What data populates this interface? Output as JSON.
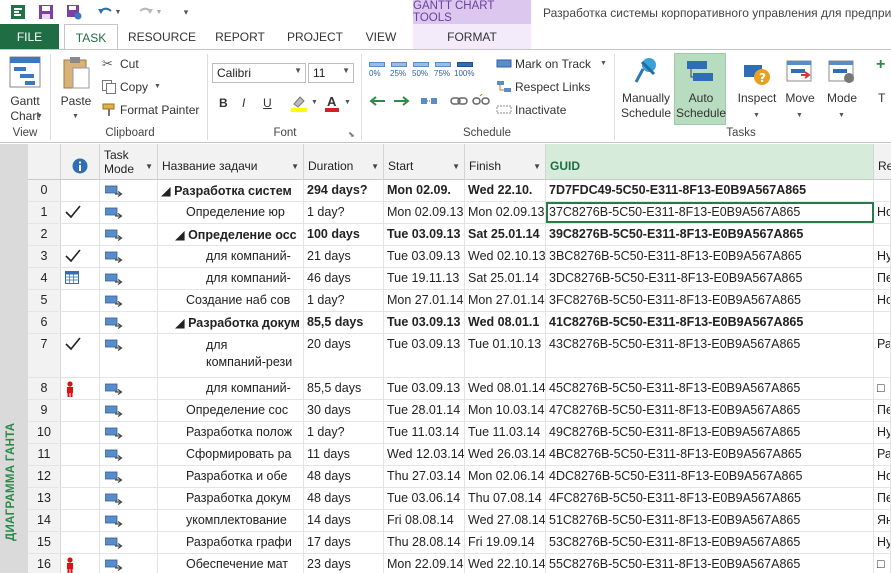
{
  "title": {
    "context_tab": "GANTT CHART TOOLS",
    "document_title": "Разработка системы корпоративного управления для предпри"
  },
  "tabs": {
    "file": "FILE",
    "task": "TASK",
    "resource": "RESOURCE",
    "report": "REPORT",
    "project": "PROJECT",
    "view": "VIEW",
    "format": "FORMAT"
  },
  "ribbon": {
    "view": {
      "gantt_line1": "Gantt",
      "gantt_line2": "Chart",
      "label": "View"
    },
    "clipboard": {
      "paste": "Paste",
      "cut": "Cut",
      "copy": "Copy",
      "format_painter": "Format Painter",
      "label": "Clipboard"
    },
    "font": {
      "family": "Calibri",
      "size": "11",
      "bold": "B",
      "italic": "I",
      "underline": "U",
      "label": "Font"
    },
    "schedule": {
      "pct": [
        "0%",
        "25%",
        "50%",
        "75%",
        "100%"
      ],
      "mark_on_track": "Mark on Track",
      "respect_links": "Respect Links",
      "inactivate": "Inactivate",
      "label": "Schedule"
    },
    "tasks": {
      "manually_line1": "Manually",
      "manually_line2": "Schedule",
      "auto_line1": "Auto",
      "auto_line2": "Schedule",
      "inspect": "Inspect",
      "move": "Move",
      "mode": "Mode",
      "label": "Tasks"
    }
  },
  "sidebar": {
    "view_name": "ДИАГРАММА ГАНТА"
  },
  "table": {
    "headers": {
      "indicator": "i",
      "task_mode_line1": "Task",
      "task_mode_line2": "Mode",
      "name": "Название задачи",
      "duration": "Duration",
      "start": "Start",
      "finish": "Finish",
      "guid": "GUID",
      "extra": "Re"
    },
    "rows": [
      {
        "id": "0",
        "ind": "",
        "name": "◢ Разработка систем",
        "level": 0,
        "bold": true,
        "duration": "294 days?",
        "start": "Mon 02.09.",
        "finish": "Wed 22.10.",
        "guid": "7D7FDC49-5C50-E311-8F13-E0B9A567A865",
        "extra": ""
      },
      {
        "id": "1",
        "ind": "check",
        "name": "Определение юр",
        "level": 2,
        "bold": false,
        "duration": "1 day?",
        "start": "Mon 02.09.13",
        "finish": "Mon 02.09.13",
        "guid": "37C8276B-5C50-E311-8F13-E0B9A567A865",
        "extra": "Но"
      },
      {
        "id": "2",
        "ind": "",
        "name": "◢ Определение осс",
        "level": 1,
        "bold": true,
        "duration": "100 days",
        "start": "Tue 03.09.13",
        "finish": "Sat 25.01.14",
        "guid": "39C8276B-5C50-E311-8F13-E0B9A567A865",
        "extra": ""
      },
      {
        "id": "3",
        "ind": "check",
        "name": "для компаний-",
        "level": 3,
        "bold": false,
        "duration": "21 days",
        "start": "Tue 03.09.13",
        "finish": "Wed 02.10.13",
        "guid": "3BC8276B-5C50-E311-8F13-E0B9A567A865",
        "extra": "Ну"
      },
      {
        "id": "4",
        "ind": "calendar",
        "name": "для компаний-",
        "level": 3,
        "bold": false,
        "duration": "46 days",
        "start": "Tue 19.11.13",
        "finish": "Sat 25.01.14",
        "guid": "3DC8276B-5C50-E311-8F13-E0B9A567A865",
        "extra": "Пе"
      },
      {
        "id": "5",
        "ind": "",
        "name": "Создание наб сов",
        "level": 2,
        "bold": false,
        "duration": "1 day?",
        "start": "Mon 27.01.14",
        "finish": "Mon 27.01.14",
        "guid": "3FC8276B-5C50-E311-8F13-E0B9A567A865",
        "extra": "Но"
      },
      {
        "id": "6",
        "ind": "",
        "name": "◢ Разработка докум",
        "level": 1,
        "bold": true,
        "duration": "85,5 days",
        "start": "Tue 03.09.13",
        "finish": "Wed 08.01.1",
        "guid": "41C8276B-5C50-E311-8F13-E0B9A567A865",
        "extra": ""
      },
      {
        "id": "7",
        "ind": "check",
        "name": "для",
        "name2": "компаний-рези",
        "level": 3,
        "bold": false,
        "duration": "20 days",
        "start": "Tue 03.09.13",
        "finish": "Tue 01.10.13",
        "guid": "43C8276B-5C50-E311-8F13-E0B9A567A865",
        "extra": "Ра"
      },
      {
        "id": "8",
        "ind": "person",
        "name": "для компаний-",
        "level": 3,
        "bold": false,
        "duration": "85,5 days",
        "start": "Tue 03.09.13",
        "finish": "Wed 08.01.14",
        "guid": "45C8276B-5C50-E311-8F13-E0B9A567A865",
        "extra": "□"
      },
      {
        "id": "9",
        "ind": "",
        "name": "Определение сос",
        "level": 2,
        "bold": false,
        "duration": "30 days",
        "start": "Tue 28.01.14",
        "finish": "Mon 10.03.14",
        "guid": "47C8276B-5C50-E311-8F13-E0B9A567A865",
        "extra": "Пе"
      },
      {
        "id": "10",
        "ind": "",
        "name": "Разработка полож",
        "level": 2,
        "bold": false,
        "duration": "1 day?",
        "start": "Tue 11.03.14",
        "finish": "Tue 11.03.14",
        "guid": "49C8276B-5C50-E311-8F13-E0B9A567A865",
        "extra": "Ну"
      },
      {
        "id": "11",
        "ind": "",
        "name": "Сформировать ра",
        "level": 2,
        "bold": false,
        "duration": "11 days",
        "start": "Wed 12.03.14",
        "finish": "Wed 26.03.14",
        "guid": "4BC8276B-5C50-E311-8F13-E0B9A567A865",
        "extra": "Ра"
      },
      {
        "id": "12",
        "ind": "",
        "name": "Разработка и обе",
        "level": 2,
        "bold": false,
        "duration": "48 days",
        "start": "Thu 27.03.14",
        "finish": "Mon 02.06.14",
        "guid": "4DC8276B-5C50-E311-8F13-E0B9A567A865",
        "extra": "Но"
      },
      {
        "id": "13",
        "ind": "",
        "name": "Разработка докум",
        "level": 2,
        "bold": false,
        "duration": "48 days",
        "start": "Tue 03.06.14",
        "finish": "Thu 07.08.14",
        "guid": "4FC8276B-5C50-E311-8F13-E0B9A567A865",
        "extra": "Пе"
      },
      {
        "id": "14",
        "ind": "",
        "name": "укомплектование",
        "level": 2,
        "bold": false,
        "duration": "14 days",
        "start": "Fri 08.08.14",
        "finish": "Wed 27.08.14",
        "guid": "51C8276B-5C50-E311-8F13-E0B9A567A865",
        "extra": "Ян"
      },
      {
        "id": "15",
        "ind": "",
        "name": "Разработка графи",
        "level": 2,
        "bold": false,
        "duration": "17 days",
        "start": "Thu 28.08.14",
        "finish": "Fri 19.09.14",
        "guid": "53C8276B-5C50-E311-8F13-E0B9A567A865",
        "extra": "Ну"
      },
      {
        "id": "16",
        "ind": "person",
        "name": "Обеспечение мат",
        "level": 2,
        "bold": false,
        "duration": "23 days",
        "start": "Mon 22.09.14",
        "finish": "Wed 22.10.14",
        "guid": "55C8276B-5C50-E311-8F13-E0B9A567A865",
        "extra": "□"
      }
    ]
  },
  "colors": {
    "file_tab": "#1f6e43",
    "accent_green": "#2a8a4a",
    "context_purple": "#dcc7ee",
    "guid_header": "#d6ebd9",
    "auto_highlight": "#b8dcc0"
  }
}
